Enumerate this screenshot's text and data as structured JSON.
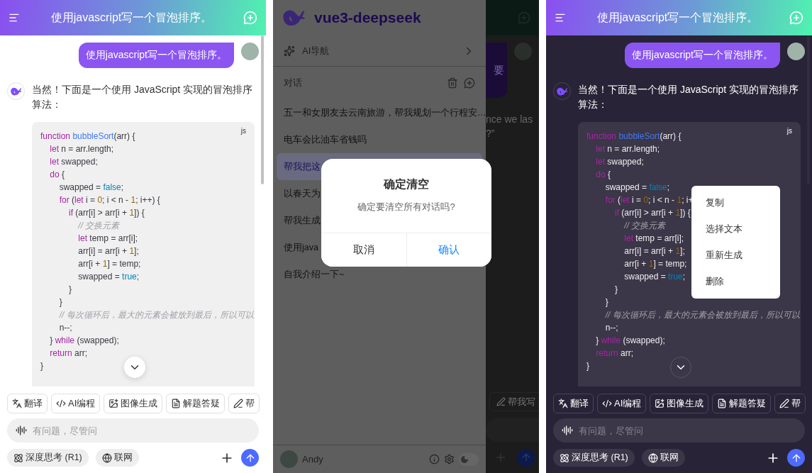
{
  "screens": [
    {
      "kind": "chat",
      "dark": false,
      "header": {
        "title": "使用javascript写一个冒泡排序。"
      },
      "user_message": "使用javascript写一个冒泡排序。",
      "assistant_text": "当然！下面是一个使用 JavaScript 实现的冒泡排序算法：",
      "code": {
        "language": "js",
        "lines": [
          [
            {
              "kind": "keyword",
              "text": "function "
            },
            {
              "kind": "function",
              "text": "bubbleSort"
            },
            {
              "kind": "plain",
              "text": "(arr) {"
            }
          ],
          [
            {
              "kind": "keyword",
              "text": "    let"
            },
            {
              "kind": "plain",
              "text": " n = arr.length;"
            }
          ],
          [
            {
              "kind": "keyword",
              "text": "    let"
            },
            {
              "kind": "plain",
              "text": " swapped;"
            }
          ],
          [
            {
              "kind": "keyword",
              "text": "    do"
            },
            {
              "kind": "plain",
              "text": " {"
            }
          ],
          [
            {
              "kind": "plain",
              "text": "        swapped = "
            },
            {
              "kind": "boolean",
              "text": "false"
            },
            {
              "kind": "plain",
              "text": ";"
            }
          ],
          [
            {
              "kind": "keyword",
              "text": "        for"
            },
            {
              "kind": "plain",
              "text": " ("
            },
            {
              "kind": "keyword",
              "text": "let"
            },
            {
              "kind": "plain",
              "text": " i = "
            },
            {
              "kind": "number",
              "text": "0"
            },
            {
              "kind": "plain",
              "text": "; i < n - "
            },
            {
              "kind": "number",
              "text": "1"
            },
            {
              "kind": "plain",
              "text": "; i++) {"
            }
          ],
          [
            {
              "kind": "keyword",
              "text": "            if"
            },
            {
              "kind": "plain",
              "text": " (arr[i] > arr[i + "
            },
            {
              "kind": "number",
              "text": "1"
            },
            {
              "kind": "plain",
              "text": "]) {"
            }
          ],
          [
            {
              "kind": "comment",
              "text": "                // 交换元素"
            }
          ],
          [
            {
              "kind": "keyword",
              "text": "                let"
            },
            {
              "kind": "plain",
              "text": " temp = arr[i];"
            }
          ],
          [
            {
              "kind": "plain",
              "text": "                arr[i] = arr[i + "
            },
            {
              "kind": "number",
              "text": "1"
            },
            {
              "kind": "plain",
              "text": "];"
            }
          ],
          [
            {
              "kind": "plain",
              "text": "                arr[i + "
            },
            {
              "kind": "number",
              "text": "1"
            },
            {
              "kind": "plain",
              "text": "] = temp;"
            }
          ],
          [
            {
              "kind": "plain",
              "text": "                swapped = "
            },
            {
              "kind": "boolean",
              "text": "true"
            },
            {
              "kind": "plain",
              "text": ";"
            }
          ],
          [
            {
              "kind": "plain",
              "text": "            }"
            }
          ],
          [
            {
              "kind": "plain",
              "text": "        }"
            }
          ],
          [
            {
              "kind": "comment",
              "text": "        // 每次循环后，最大的元素会被放到最后，所以可以"
            }
          ],
          [
            {
              "kind": "plain",
              "text": "        n--;"
            }
          ],
          [
            {
              "kind": "plain",
              "text": "    } "
            },
            {
              "kind": "keyword",
              "text": "while"
            },
            {
              "kind": "plain",
              "text": " (swapped);"
            }
          ],
          [
            {
              "kind": "keyword",
              "text": "    return"
            },
            {
              "kind": "plain",
              "text": " arr;"
            }
          ],
          [
            {
              "kind": "plain",
              "text": "}"
            }
          ]
        ]
      },
      "chips": [
        {
          "kind": "translate",
          "label": "翻译"
        },
        {
          "kind": "code",
          "label": "AI编程"
        },
        {
          "kind": "image",
          "label": "图像生成"
        },
        {
          "kind": "solve",
          "label": "解题答疑"
        },
        {
          "kind": "write",
          "label": "帮"
        }
      ],
      "input": {
        "placeholder": "有问题，尽管问"
      },
      "toggles": [
        "深度思考 (R1)",
        "联网"
      ]
    },
    {
      "kind": "drawer",
      "app_name": "vue3-deepseek",
      "nav": {
        "label": "AI导航"
      },
      "section": "对话",
      "conversations": [
        {
          "title": "五一和女朋友去云南旅游，帮我规划一个行程安…",
          "selected": false
        },
        {
          "title": "电车会比油车省钱吗",
          "selected": false
        },
        {
          "title": "帮我把这",
          "selected": true
        },
        {
          "title": "以春天为",
          "selected": false
        },
        {
          "title": "帮我生成",
          "selected": false
        },
        {
          "title": "使用java",
          "selected": false
        },
        {
          "title": "自我介绍一下~",
          "selected": false
        }
      ],
      "user": {
        "name": "Andy"
      },
      "theme_switch": {
        "on": false
      },
      "background": {
        "bubble_text": "要",
        "lines": [
          "nce we las",
          "?”"
        ],
        "chip": "帮我写"
      },
      "dialog": {
        "title": "确定清空",
        "message": "确定要清空所有对话吗?",
        "buttons": [
          {
            "label": "取消",
            "kind": "cancel"
          },
          {
            "label": "确认",
            "kind": "confirm"
          }
        ]
      }
    },
    {
      "kind": "chat",
      "dark": true,
      "header": {
        "title": "使用javascript写一个冒泡排序。"
      },
      "user_message": "使用javascript写一个冒泡排序。",
      "assistant_text": "当然！下面是一个使用 JavaScript 实现的冒泡排序算法：",
      "code": {
        "language": "js",
        "lines": [
          [
            {
              "kind": "keyword",
              "text": "function "
            },
            {
              "kind": "function",
              "text": "bubbleSort"
            },
            {
              "kind": "plain",
              "text": "(arr) {"
            }
          ],
          [
            {
              "kind": "keyword",
              "text": "    let"
            },
            {
              "kind": "plain",
              "text": " n = arr.length;"
            }
          ],
          [
            {
              "kind": "keyword",
              "text": "    let"
            },
            {
              "kind": "plain",
              "text": " swapped;"
            }
          ],
          [
            {
              "kind": "keyword",
              "text": "    do"
            },
            {
              "kind": "plain",
              "text": " {"
            }
          ],
          [
            {
              "kind": "plain",
              "text": "        swapped = "
            },
            {
              "kind": "boolean",
              "text": "false"
            },
            {
              "kind": "plain",
              "text": ";"
            }
          ],
          [
            {
              "kind": "keyword",
              "text": "        for"
            },
            {
              "kind": "plain",
              "text": " ("
            },
            {
              "kind": "keyword",
              "text": "let"
            },
            {
              "kind": "plain",
              "text": " i = "
            },
            {
              "kind": "number",
              "text": "0"
            },
            {
              "kind": "plain",
              "text": "; i < n - "
            },
            {
              "kind": "number",
              "text": "1"
            },
            {
              "kind": "plain",
              "text": "; i+"
            }
          ],
          [
            {
              "kind": "keyword",
              "text": "            if"
            },
            {
              "kind": "plain",
              "text": " (arr[i] > arr[i + "
            },
            {
              "kind": "number",
              "text": "1"
            },
            {
              "kind": "plain",
              "text": "]) {"
            }
          ],
          [
            {
              "kind": "comment",
              "text": "                // 交换元素"
            }
          ],
          [
            {
              "kind": "keyword",
              "text": "                let"
            },
            {
              "kind": "plain",
              "text": " temp = arr[i];"
            }
          ],
          [
            {
              "kind": "plain",
              "text": "                arr[i] = arr[i + "
            },
            {
              "kind": "number",
              "text": "1"
            },
            {
              "kind": "plain",
              "text": "];"
            }
          ],
          [
            {
              "kind": "plain",
              "text": "                arr[i + "
            },
            {
              "kind": "number",
              "text": "1"
            },
            {
              "kind": "plain",
              "text": "] = temp;"
            }
          ],
          [
            {
              "kind": "plain",
              "text": "                swapped = "
            },
            {
              "kind": "boolean",
              "text": "true"
            },
            {
              "kind": "plain",
              "text": ";"
            }
          ],
          [
            {
              "kind": "plain",
              "text": "            }"
            }
          ],
          [
            {
              "kind": "plain",
              "text": "        }"
            }
          ],
          [
            {
              "kind": "comment",
              "text": "        // 每次循环后，最大的元素会被放到最后，所以可以"
            }
          ],
          [
            {
              "kind": "plain",
              "text": "        n--;"
            }
          ],
          [
            {
              "kind": "plain",
              "text": "    } "
            },
            {
              "kind": "keyword",
              "text": "while"
            },
            {
              "kind": "plain",
              "text": " (swapped);"
            }
          ],
          [
            {
              "kind": "keyword",
              "text": "    return"
            },
            {
              "kind": "plain",
              "text": " arr;"
            }
          ],
          [
            {
              "kind": "plain",
              "text": "}"
            }
          ]
        ]
      },
      "context_menu": [
        "复制",
        "选择文本",
        "重新生成",
        "删除"
      ],
      "chips": [
        {
          "kind": "translate",
          "label": "翻译"
        },
        {
          "kind": "code",
          "label": "AI编程"
        },
        {
          "kind": "image",
          "label": "图像生成"
        },
        {
          "kind": "solve",
          "label": "解题答疑"
        },
        {
          "kind": "write",
          "label": "帮"
        }
      ],
      "input": {
        "placeholder": "有问题，尽管问"
      },
      "toggles": [
        "深度思考 (R1)",
        "联网"
      ]
    }
  ]
}
